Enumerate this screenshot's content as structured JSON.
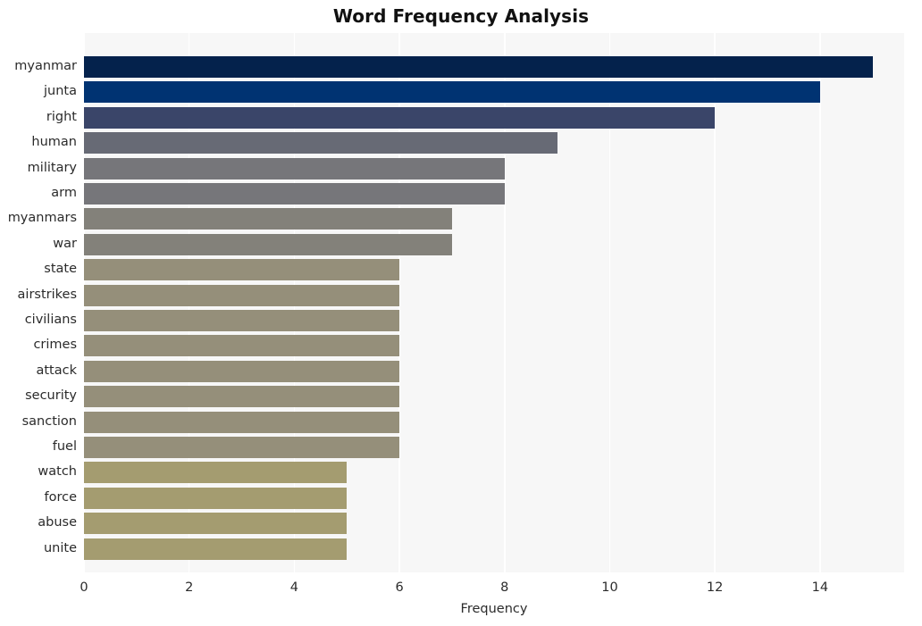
{
  "chart_data": {
    "type": "bar",
    "orientation": "horizontal",
    "title": "Word Frequency Analysis",
    "xlabel": "Frequency",
    "ylabel": "",
    "categories": [
      "myanmar",
      "junta",
      "right",
      "human",
      "military",
      "arm",
      "myanmars",
      "war",
      "state",
      "airstrikes",
      "civilians",
      "crimes",
      "attack",
      "security",
      "sanction",
      "fuel",
      "watch",
      "force",
      "abuse",
      "unite"
    ],
    "values": [
      15,
      14,
      12,
      9,
      8,
      8,
      7,
      7,
      6,
      6,
      6,
      6,
      6,
      6,
      6,
      6,
      5,
      5,
      5,
      5
    ],
    "bar_colors": [
      "#04224c",
      "#003372",
      "#3a4569",
      "#676a75",
      "#76767a",
      "#76767a",
      "#83817a",
      "#83817a",
      "#958f7a",
      "#958f7a",
      "#958f7a",
      "#958f7a",
      "#958f7a",
      "#958f7a",
      "#958f7a",
      "#958f7a",
      "#a49c70",
      "#a49c70",
      "#a49c70",
      "#a49c70"
    ],
    "xlim": [
      0,
      15.6
    ],
    "xticks": [
      0,
      2,
      4,
      6,
      8,
      10,
      12,
      14
    ],
    "xtick_labels": [
      "0",
      "2",
      "4",
      "6",
      "8",
      "10",
      "12",
      "14"
    ],
    "grid": true,
    "grid_axis": "x",
    "grid_color": "#ffffff",
    "plot_background": "#f7f7f7",
    "figure_background": "#ffffff",
    "legend": null
  }
}
